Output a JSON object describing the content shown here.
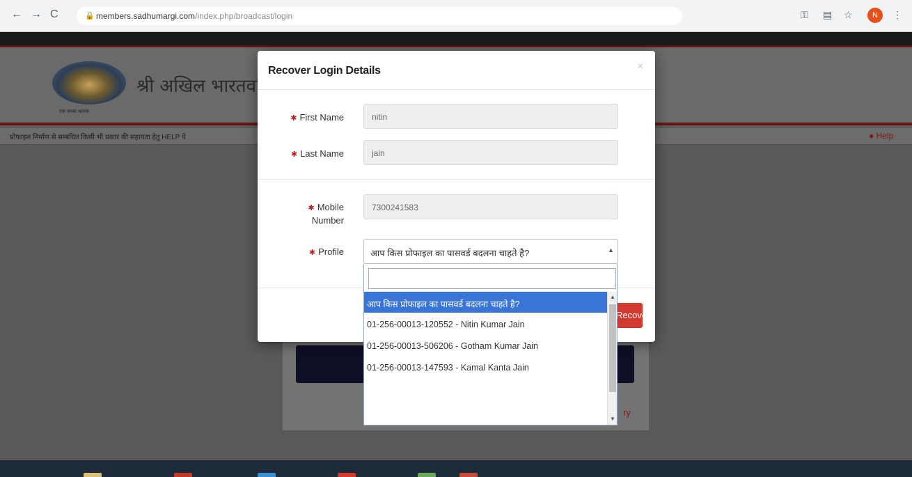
{
  "browser": {
    "back_icon": "arrow-left-icon",
    "forward_icon": "arrow-right-icon",
    "reload_icon": "reload-icon",
    "url_host": "members.sadhumargi.com",
    "url_path": "/index.php/broadcast/login",
    "avatar_initial": "N"
  },
  "page": {
    "site_title": "श्री अखिल भारतवर्षि",
    "logo_tagline": "एक सच्चा श्रावक",
    "info_strip": "प्रोफाइल निर्माण से सम्बंधित किसी भी प्रकार की सहायता हेतु HELP पे",
    "help_label": "Help"
  },
  "modal": {
    "title": "Recover Login Details",
    "close": "×",
    "fields": {
      "first_name": {
        "label": "First Name",
        "value": "nitin"
      },
      "last_name": {
        "label": "Last Name",
        "value": "jain"
      },
      "mobile": {
        "label_line1": "Mobile",
        "label_line2": "Number",
        "value": "7300241583"
      },
      "profile": {
        "label": "Profile",
        "selected": "आप किस प्रोफाइल का पासवर्ड बदलना चाहते है?"
      }
    },
    "recover_button": "Recover"
  },
  "dropdown": {
    "search_value": "",
    "options": [
      {
        "label": "आप किस प्रोफाइल का पासवर्ड बदलना चाहते है?",
        "active": true
      },
      {
        "label": "01-256-00013-120552 -  Nitin Kumar  Jain",
        "active": false
      },
      {
        "label": "01-256-00013-506206 -  Gotham Kumar  Jain",
        "active": false
      },
      {
        "label": "01-256-00013-147593 -  Kamal Kanta  Jain",
        "active": false
      }
    ]
  },
  "colors": {
    "required_marker": "#b32323",
    "active_option": "#3875d7",
    "recover_button": "#d33a2f"
  }
}
